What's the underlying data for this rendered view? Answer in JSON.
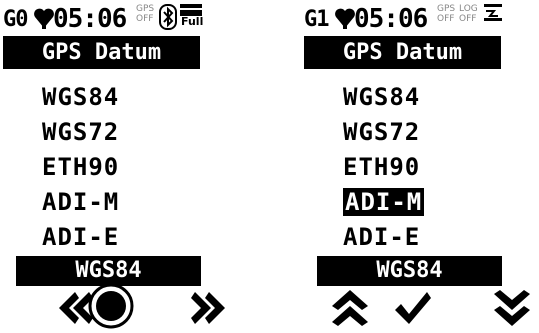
{
  "screens": [
    {
      "status": {
        "mode": "G0",
        "time": "05:06",
        "gps_top": "GPS",
        "gps_bottom": "OFF",
        "battery_label": "Full"
      },
      "title": "GPS Datum",
      "items": [
        "WGS84",
        "WGS72",
        "ETH90",
        "ADI-M",
        "ADI-E"
      ],
      "current": "WGS84",
      "buttons": [
        "rewind-icon",
        "circle-icon",
        "fast-forward-icon"
      ]
    },
    {
      "status": {
        "mode": "G1",
        "time": "05:06",
        "gps_top": "GPS",
        "gps_bottom": "OFF",
        "log_top": "LOG",
        "log_bottom": "OFF"
      },
      "title": "GPS Datum",
      "items": [
        "WGS84",
        "WGS72",
        "ETH90",
        "ADI-M",
        "ADI-E"
      ],
      "selected_item": "ADI-M",
      "current": "WGS84",
      "buttons": [
        "up-icon",
        "checkmark-icon",
        "down-icon"
      ]
    }
  ]
}
